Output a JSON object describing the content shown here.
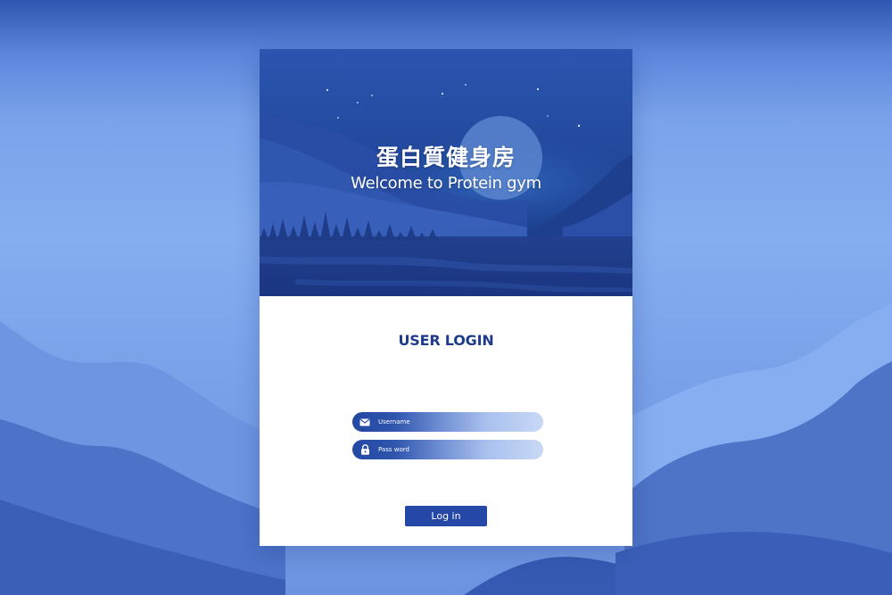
{
  "hero": {
    "title": "蛋白質健身房",
    "subtitle": "Welcome to Protein gym"
  },
  "login": {
    "heading": "USER LOGIN",
    "username": {
      "placeholder": "Username",
      "value": "",
      "icon": "envelope-icon"
    },
    "password": {
      "placeholder": "Pass word",
      "value": "",
      "icon": "padlock-icon"
    },
    "button_label": "Log in"
  },
  "colors": {
    "primary": "#2548a6",
    "heading": "#1f3c8c",
    "background": "#7aa3ea",
    "card": "#ffffff"
  }
}
